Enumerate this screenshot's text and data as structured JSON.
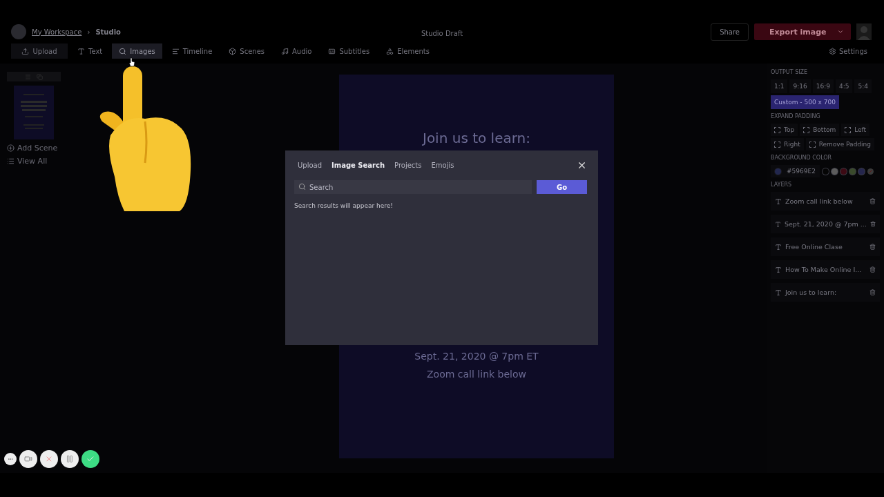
{
  "header": {
    "workspace": "My Workspace",
    "separator": "›",
    "current": "Studio",
    "title": "Studio Draft",
    "share": "Share",
    "export": "Export image"
  },
  "toolbar": [
    {
      "kind": "upload",
      "label": "Upload",
      "selected": false
    },
    {
      "kind": "text",
      "label": "Text",
      "selected": false
    },
    {
      "kind": "images",
      "label": "Images",
      "selected": true
    },
    {
      "kind": "timeline",
      "label": "Timeline",
      "selected": false
    },
    {
      "kind": "scenes",
      "label": "Scenes",
      "selected": false
    },
    {
      "kind": "audio",
      "label": "Audio",
      "selected": false
    },
    {
      "kind": "subtitles",
      "label": "Subtitles",
      "selected": false
    },
    {
      "kind": "elements",
      "label": "Elements",
      "selected": false
    }
  ],
  "settings": "Settings",
  "sidebar": {
    "add_scene": "Add Scene",
    "view_all": "View All"
  },
  "canvas": {
    "texts": [
      "Join us to learn:",
      "Sept. 21, 2020 @ 7pm ET",
      "Zoom call link below"
    ]
  },
  "modal": {
    "tabs": [
      {
        "label": "Upload",
        "selected": false
      },
      {
        "label": "Image Search",
        "selected": true
      },
      {
        "label": "Projects",
        "selected": false
      },
      {
        "label": "Emojis",
        "selected": false
      }
    ],
    "search": {
      "placeholder": "Search"
    },
    "go": "Go",
    "message": "Search results will appear here!"
  },
  "panel": {
    "output_size": {
      "heading": "OUTPUT SIZE",
      "ratios": [
        {
          "label": "1:1",
          "selected": false
        },
        {
          "label": "9:16",
          "selected": false
        },
        {
          "label": "16:9",
          "selected": false
        },
        {
          "label": "4:5",
          "selected": false
        },
        {
          "label": "5:4",
          "selected": false
        },
        {
          "label": "Custom - 500 x 700",
          "selected": true
        }
      ]
    },
    "padding": {
      "heading": "EXPAND PADDING",
      "options": [
        {
          "label": "Top",
          "checked": false
        },
        {
          "label": "Bottom",
          "checked": false
        },
        {
          "label": "Left",
          "checked": false
        },
        {
          "label": "Right",
          "checked": false
        },
        {
          "label": "Remove Padding",
          "checked": false
        }
      ]
    },
    "background": {
      "heading": "BACKGROUND COLOR",
      "value": "#5969E2",
      "swatches": [
        {
          "kind": "color",
          "color": "#050505"
        },
        {
          "kind": "color",
          "color": "#5c5c5c"
        },
        {
          "kind": "color",
          "color": "#3d0a14"
        },
        {
          "kind": "color",
          "color": "#3a4a2c"
        },
        {
          "kind": "color",
          "color": "#25264d"
        },
        {
          "kind": "none"
        }
      ]
    },
    "layers": {
      "heading": "LAYERS",
      "items": [
        "Zoom call link below",
        "Sept. 21, 2020 @ 7pm ...",
        "Free Online Clase",
        "How To Make Online I...",
        "Join us to learn:"
      ]
    }
  },
  "recorder": [
    {
      "kind": "more"
    },
    {
      "kind": "camera"
    },
    {
      "kind": "cancel"
    },
    {
      "kind": "pause"
    },
    {
      "kind": "done"
    }
  ]
}
